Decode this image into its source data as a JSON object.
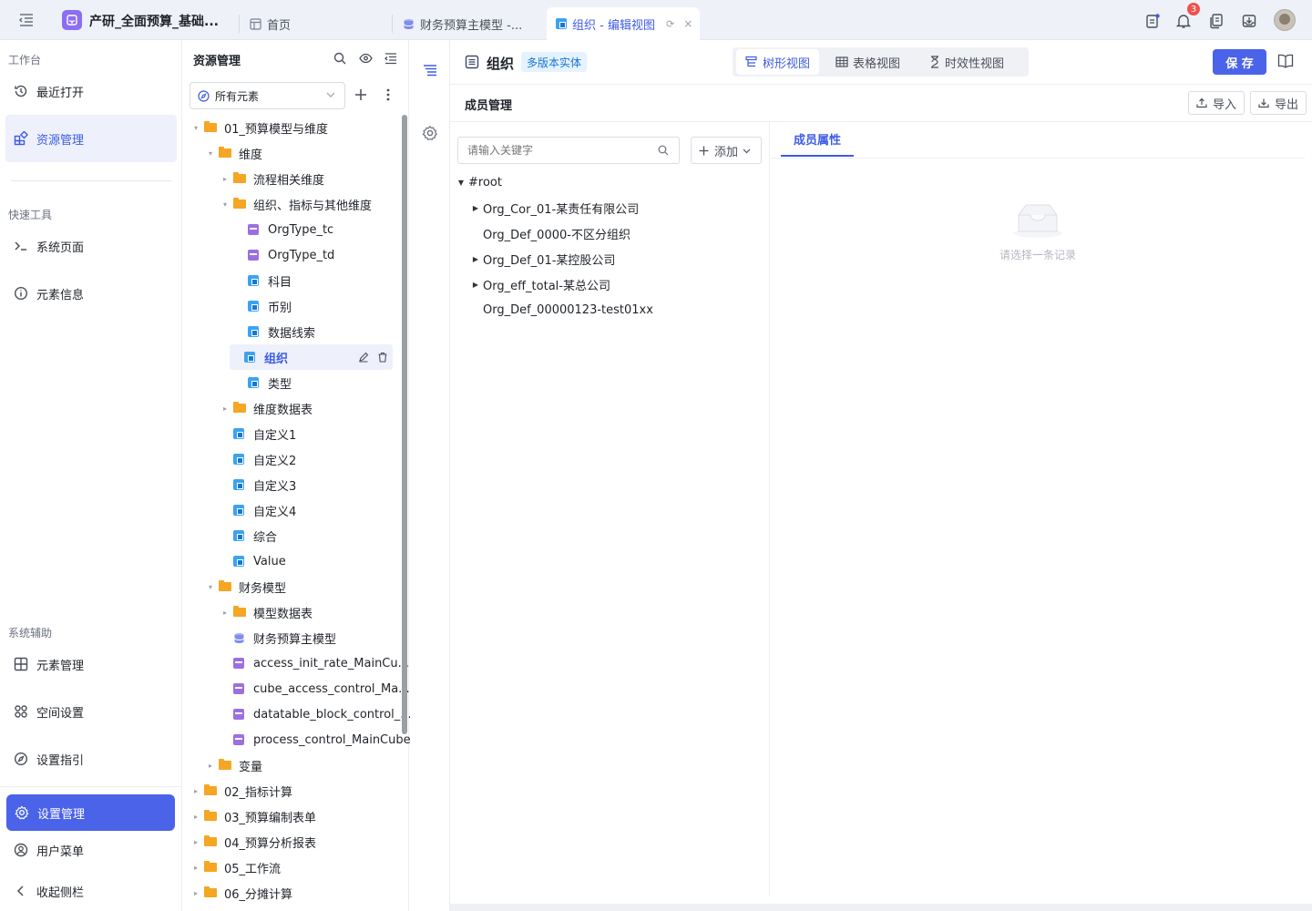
{
  "topbar": {
    "project_title": "产研_全面预算_基础...",
    "tabs": [
      {
        "label": "首页"
      },
      {
        "label": "财务预算主模型 -..."
      },
      {
        "label": "组织 - 编辑视图"
      }
    ],
    "notification_count": "3"
  },
  "leftnav": {
    "workbench_heading": "工作台",
    "recent": "最近打开",
    "resource_mgmt": "资源管理",
    "quick_tools_heading": "快速工具",
    "system_page": "系统页面",
    "element_info": "元素信息",
    "sys_aux_heading": "系统辅助",
    "element_mgmt": "元素管理",
    "space_settings": "空间设置",
    "setup_guide": "设置指引",
    "settings_mgmt": "设置管理",
    "user_menu": "用户菜单",
    "collapse": "收起侧栏"
  },
  "resources": {
    "title": "资源管理",
    "filter_value": "所有元素",
    "tree": [
      {
        "label": "01_预算模型与维度",
        "type": "folder",
        "expand": "open"
      },
      {
        "label": "维度",
        "type": "folder",
        "expand": "open"
      },
      {
        "label": "流程相关维度",
        "type": "folder",
        "expand": "closed"
      },
      {
        "label": "组织、指标与其他维度",
        "type": "folder",
        "expand": "open"
      },
      {
        "label": "OrgType_tc",
        "type": "cube"
      },
      {
        "label": "OrgType_td",
        "type": "cube"
      },
      {
        "label": "科目",
        "type": "dim"
      },
      {
        "label": "币别",
        "type": "dim"
      },
      {
        "label": "数据线索",
        "type": "dim"
      },
      {
        "label": "组织",
        "type": "dim",
        "selected": true
      },
      {
        "label": "类型",
        "type": "dim"
      },
      {
        "label": "维度数据表",
        "type": "folder",
        "expand": "closed"
      },
      {
        "label": "自定义1",
        "type": "dim"
      },
      {
        "label": "自定义2",
        "type": "dim"
      },
      {
        "label": "自定义3",
        "type": "dim"
      },
      {
        "label": "自定义4",
        "type": "dim"
      },
      {
        "label": "综合",
        "type": "dim"
      },
      {
        "label": "Value",
        "type": "dim"
      },
      {
        "label": "财务模型",
        "type": "folder",
        "expand": "open"
      },
      {
        "label": "模型数据表",
        "type": "folder",
        "expand": "closed"
      },
      {
        "label": "财务预算主模型",
        "type": "model"
      },
      {
        "label": "access_init_rate_MainCu...",
        "type": "cube"
      },
      {
        "label": "cube_access_control_Ma...",
        "type": "cube"
      },
      {
        "label": "datatable_block_control_...",
        "type": "cube"
      },
      {
        "label": "process_control_MainCube",
        "type": "cube"
      },
      {
        "label": "变量",
        "type": "folder",
        "expand": "closed"
      },
      {
        "label": "02_指标计算",
        "type": "folder",
        "expand": "closed"
      },
      {
        "label": "03_预算编制表单",
        "type": "folder",
        "expand": "closed"
      },
      {
        "label": "04_预算分析报表",
        "type": "folder",
        "expand": "closed"
      },
      {
        "label": "05_工作流",
        "type": "folder",
        "expand": "closed"
      },
      {
        "label": "06_分摊计算",
        "type": "folder",
        "expand": "closed"
      }
    ]
  },
  "main": {
    "title": "组织",
    "badge": "多版本实体",
    "view_tabs": [
      "树形视图",
      "表格视图",
      "时效性视图"
    ],
    "save": "保 存",
    "section_title": "成员管理",
    "import": "导入",
    "export": "导出",
    "search_placeholder": "请输入关键字",
    "add": "添加",
    "members": [
      {
        "label": "#root",
        "expand": "open"
      },
      {
        "label": "Org_Cor_01-某责任有限公司",
        "expand": "closed"
      },
      {
        "label": "Org_Def_0000-不区分组织",
        "expand": "none"
      },
      {
        "label": "Org_Def_01-某控股公司",
        "expand": "closed"
      },
      {
        "label": "Org_eff_total-某总公司",
        "expand": "closed"
      },
      {
        "label": "Org_Def_00000123-test01xx",
        "expand": "none"
      }
    ],
    "prop_tab": "成员属性",
    "empty_text": "请选择一条记录"
  },
  "colors": {
    "accent": "#3e5be6",
    "folder": "#f5a623",
    "settings_bg": "#4a63e8"
  }
}
